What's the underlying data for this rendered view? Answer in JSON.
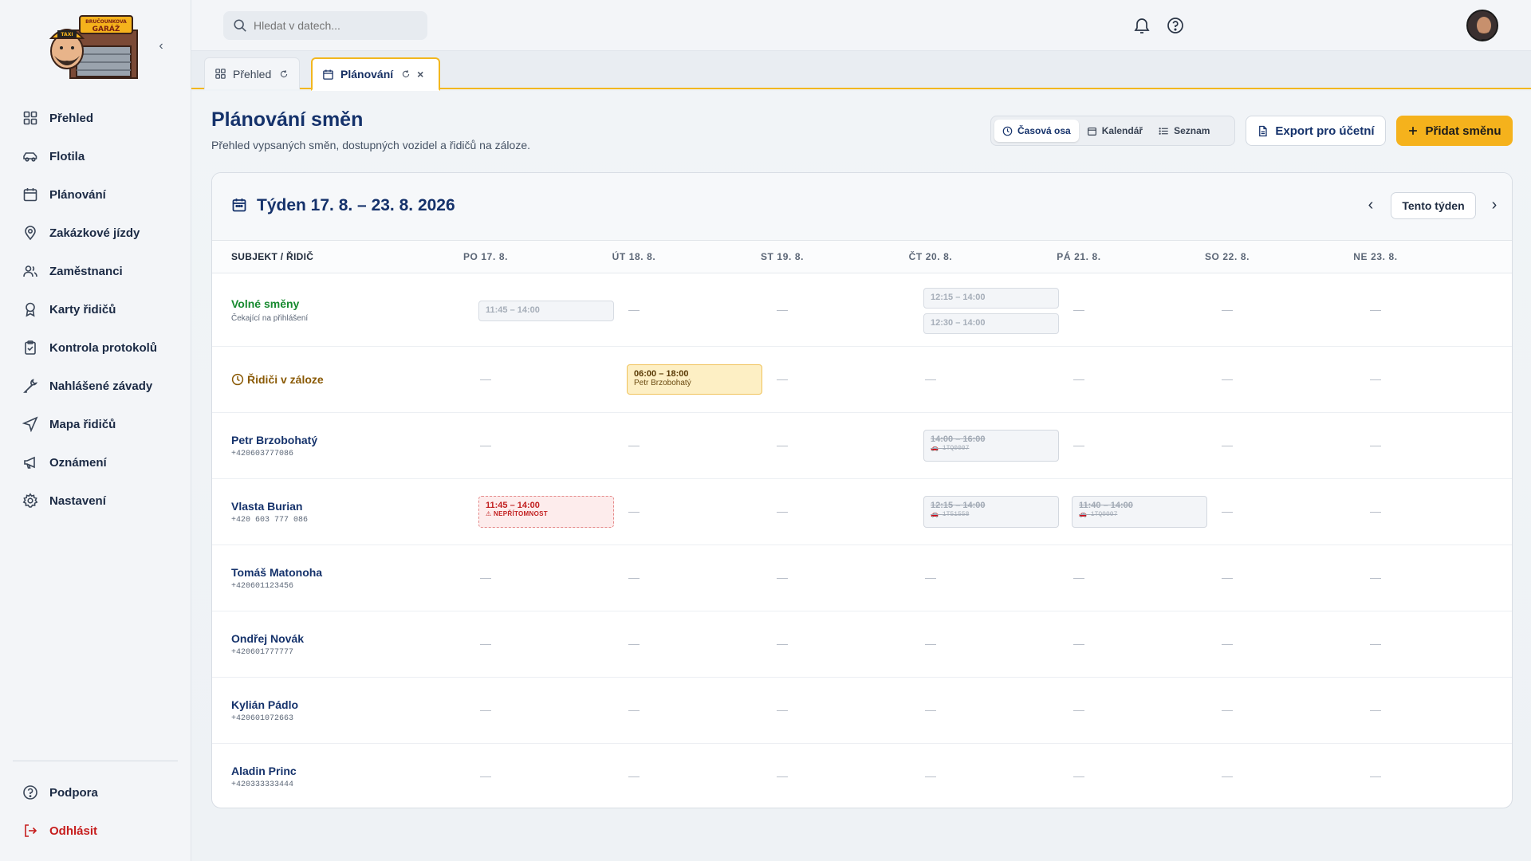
{
  "brand": {
    "logo_text_1": "BRUČOUNKOVA",
    "logo_text_2": "GARÁŽ",
    "logo_taxi": "TAXI"
  },
  "sidebar": {
    "items": [
      {
        "label": "Přehled",
        "icon": "grid-icon"
      },
      {
        "label": "Flotila",
        "icon": "car-icon"
      },
      {
        "label": "Plánování",
        "icon": "calendar-icon"
      },
      {
        "label": "Zakázkové jízdy",
        "icon": "map-pin-icon"
      },
      {
        "label": "Zaměstnanci",
        "icon": "users-icon"
      },
      {
        "label": "Karty řidičů",
        "icon": "badge-icon"
      },
      {
        "label": "Kontrola protokolů",
        "icon": "clipboard-check-icon"
      },
      {
        "label": "Nahlášené závady",
        "icon": "wrench-icon"
      },
      {
        "label": "Mapa řidičů",
        "icon": "navigation-icon"
      },
      {
        "label": "Oznámení",
        "icon": "megaphone-icon"
      },
      {
        "label": "Nastavení",
        "icon": "gear-icon"
      }
    ],
    "bottom": [
      {
        "label": "Podpora",
        "icon": "help-icon"
      },
      {
        "label": "Odhlásit",
        "icon": "logout-icon"
      }
    ]
  },
  "search": {
    "placeholder": "Hledat v datech..."
  },
  "tabs": [
    {
      "label": "Přehled"
    },
    {
      "label": "Plánování"
    }
  ],
  "page": {
    "title": "Plánování směn",
    "subtitle": "Přehled vypsaných směn, dostupných vozidel a řidičů na záloze."
  },
  "view_switch": [
    "Časová osa",
    "Kalendář",
    "Seznam"
  ],
  "actions": {
    "export": "Export pro účetní",
    "add": "Přidat směnu"
  },
  "week": {
    "title": "Týden 17. 8. – 23. 8. 2026",
    "today": "Tento týden"
  },
  "grid": {
    "subject_header": "SUBJEKT / ŘIDIČ",
    "days": [
      "PO 17. 8.",
      "ÚT 18. 8.",
      "ST 19. 8.",
      "ČT 20. 8.",
      "PÁ 21. 8.",
      "SO 22. 8.",
      "NE 23. 8."
    ],
    "empty": "—",
    "rows": [
      {
        "name": "Volné směny",
        "sub": "Čekající na přihlášení"
      },
      {
        "name": "Řidiči v záloze",
        "sub": ""
      },
      {
        "name": "Petr Brzobohatý",
        "sub": "+420603777086"
      },
      {
        "name": "Vlasta Burian",
        "sub": "+420 603 777 086"
      },
      {
        "name": "Tomáš Matonoha",
        "sub": "+420601123456"
      },
      {
        "name": "Ondřej Novák",
        "sub": "+420601777777"
      },
      {
        "name": "Kylián Pádlo",
        "sub": "+420601072663"
      },
      {
        "name": "Aladin Princ",
        "sub": "+420333333444"
      }
    ],
    "shifts": {
      "open_mon": "11:45 – 14:00",
      "open_thu_1": "12:15 – 14:00",
      "open_thu_2": "12:30 – 14:00",
      "reserve_tue_time": "06:00 – 18:00",
      "reserve_tue_name": "Petr Brzobohatý",
      "petr_thu_time": "14:00 – 16:00",
      "petr_thu_car": "1TQ0007",
      "vlasta_mon_time": "11:45 – 14:00",
      "vlasta_mon_status": "NEPŘÍTOMNOST",
      "vlasta_thu_time": "12:15 – 14:00",
      "vlasta_thu_car": "1T51558",
      "vlasta_fri_time": "11:40 – 14:00",
      "vlasta_fri_car": "1TQ0007"
    }
  },
  "colors": {
    "accent": "#f5b21c",
    "primary": "#15326b",
    "open_green": "#178a2f",
    "reserve_brown": "#8a5a06",
    "danger": "#c22020"
  }
}
